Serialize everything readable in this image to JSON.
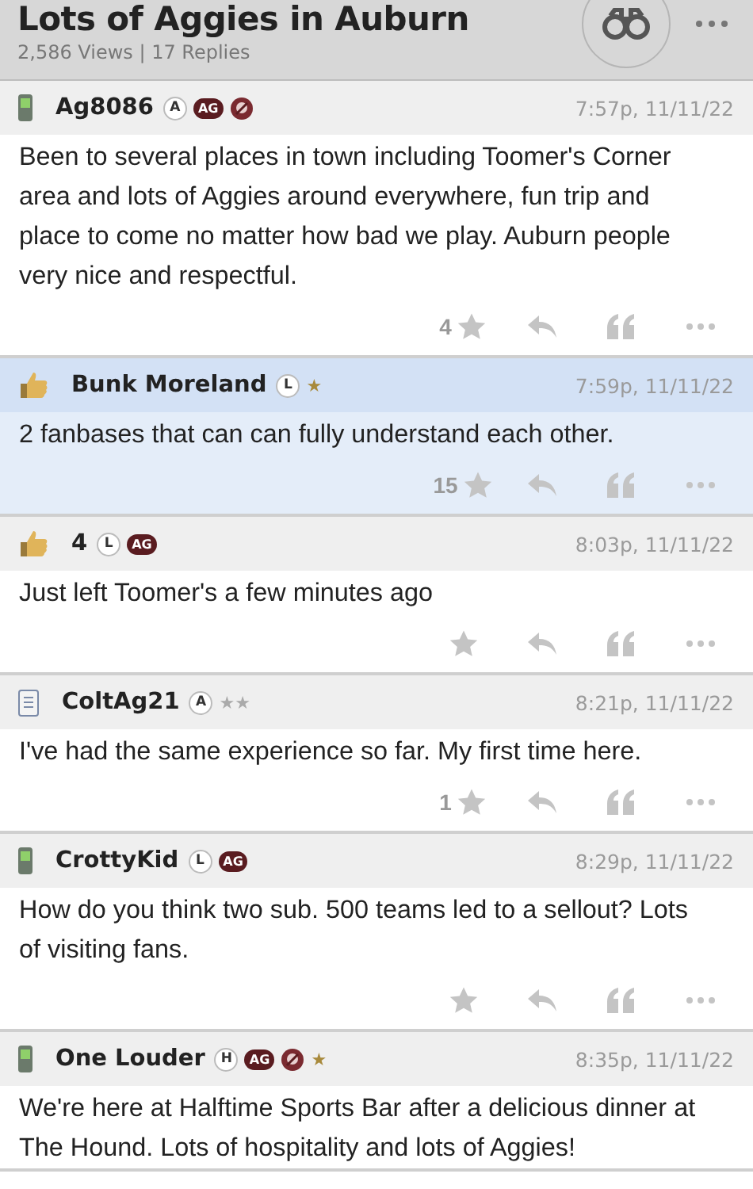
{
  "topic": {
    "title": "Lots of Aggies in Auburn",
    "stats": "2,586 Views | 17 Replies"
  },
  "posts": [
    {
      "kind": "phone",
      "author": "Ag8086",
      "badges": [
        {
          "kind": "letter",
          "text": "A"
        },
        {
          "kind": "tag",
          "text": "AG"
        },
        {
          "kind": "logo"
        }
      ],
      "time": "7:57p, 11/11/22",
      "highlighted": false,
      "text": "Been to several places in town including Toomer's Corner area and lots of Aggies around everywhere, fun trip and place to come no matter how bad we play. Auburn people very nice and respectful.",
      "star_count": "4"
    },
    {
      "kind": "thumb",
      "author": "Bunk Moreland",
      "badges": [
        {
          "kind": "letter",
          "text": "L"
        },
        {
          "kind": "star",
          "text": "★"
        }
      ],
      "time": "7:59p, 11/11/22",
      "highlighted": true,
      "text": "2 fanbases that can can fully understand each other.",
      "star_count": "15"
    },
    {
      "kind": "thumb",
      "author": "4",
      "badges": [
        {
          "kind": "letter",
          "text": "L"
        },
        {
          "kind": "tag",
          "text": "AG"
        }
      ],
      "time": "8:03p, 11/11/22",
      "highlighted": false,
      "text": "Just left Toomer's a few minutes ago"
    },
    {
      "kind": "note",
      "author": "ColtAg21",
      "badges": [
        {
          "kind": "letter",
          "text": "A"
        },
        {
          "kind": "grey-star",
          "text": "★★"
        }
      ],
      "time": "8:21p, 11/11/22",
      "highlighted": false,
      "text": "I've had the same experience so far. My first time here.",
      "star_count": "1"
    },
    {
      "kind": "phone",
      "author": "CrottyKid",
      "badges": [
        {
          "kind": "letter",
          "text": "L"
        },
        {
          "kind": "tag",
          "text": "AG"
        }
      ],
      "time": "8:29p, 11/11/22",
      "highlighted": false,
      "text": "How do you think two sub. 500 teams led to a sellout? Lots of visiting fans."
    },
    {
      "kind": "phone",
      "author": "One Louder",
      "badges": [
        {
          "kind": "letter",
          "text": "H"
        },
        {
          "kind": "tag",
          "text": "AG"
        },
        {
          "kind": "logo"
        },
        {
          "kind": "star",
          "text": "★"
        }
      ],
      "time": "8:35p, 11/11/22",
      "highlighted": false,
      "text": "We're here at Halftime Sports Bar after a delicious dinner at The Hound. Lots of hospitality and lots of Aggies!",
      "actions_shown": false
    }
  ]
}
